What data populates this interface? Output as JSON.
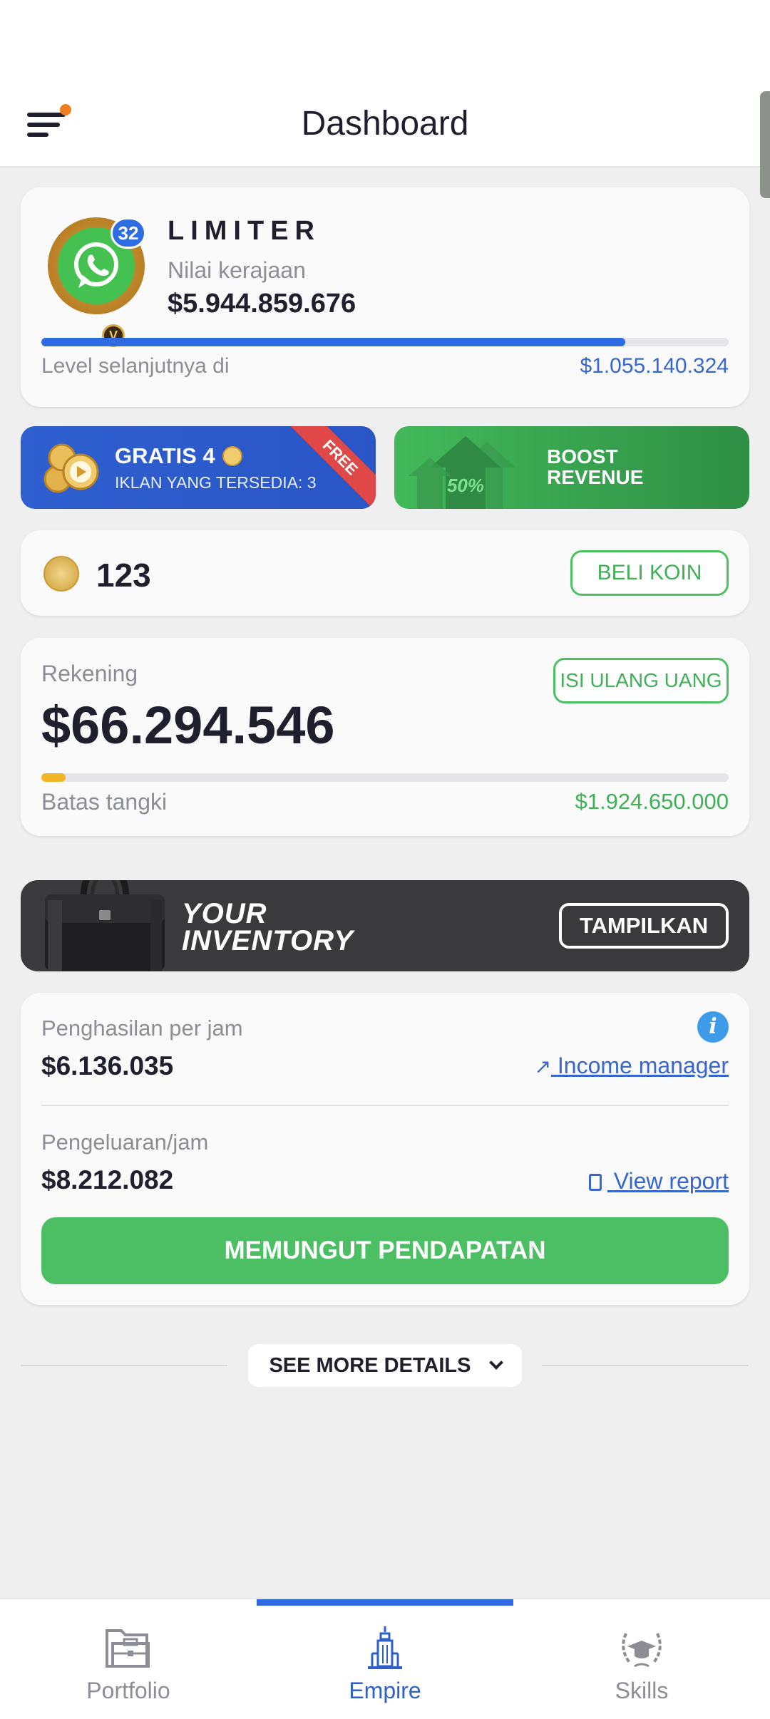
{
  "header": {
    "title": "Dashboard"
  },
  "profile": {
    "level_badge": "32",
    "name": "LIMITER",
    "value_label": "Nilai kerajaan",
    "value": "$5.944.859.676",
    "progress": 0.85,
    "next_level_label": "Level selanjutnya di",
    "next_level_value": "$1.055.140.324"
  },
  "promo": {
    "gratis_title": "GRATIS 4",
    "gratis_subtitle": "IKLAN YANG TERSEDIA: 3",
    "ribbon": "FREE",
    "boost_percent": "50%",
    "boost_line1": "BOOST",
    "boost_line2": "REVENUE"
  },
  "coins": {
    "value": "123",
    "buy_button": "BELI KOIN"
  },
  "account": {
    "label": "Rekening",
    "value": "$66.294.546",
    "topup_button": "ISI ULANG UANG",
    "tank_fill": 0.035,
    "tank_label": "Batas tangki",
    "tank_value": "$1.924.650.000"
  },
  "inventory": {
    "line1": "YOUR",
    "line2": "INVENTORY",
    "button": "TAMPILKAN"
  },
  "income": {
    "per_hour_label": "Penghasilan per jam",
    "per_hour_value": "$6.136.035",
    "manager_link": "Income manager",
    "expense_label": "Pengeluaran/jam",
    "expense_value": "$8.212.082",
    "report_link": "View report",
    "collect_button": "MEMUNGUT PENDAPATAN"
  },
  "more": {
    "label": "SEE MORE DETAILS"
  },
  "tabs": [
    {
      "label": "Portfolio",
      "icon": "briefcase-folder-icon"
    },
    {
      "label": "Empire",
      "icon": "building-icon"
    },
    {
      "label": "Skills",
      "icon": "laurel-graduation-icon"
    }
  ],
  "colors": {
    "accent": "#2f6ae0",
    "green": "#4cbf64",
    "gold": "#f2b526"
  }
}
